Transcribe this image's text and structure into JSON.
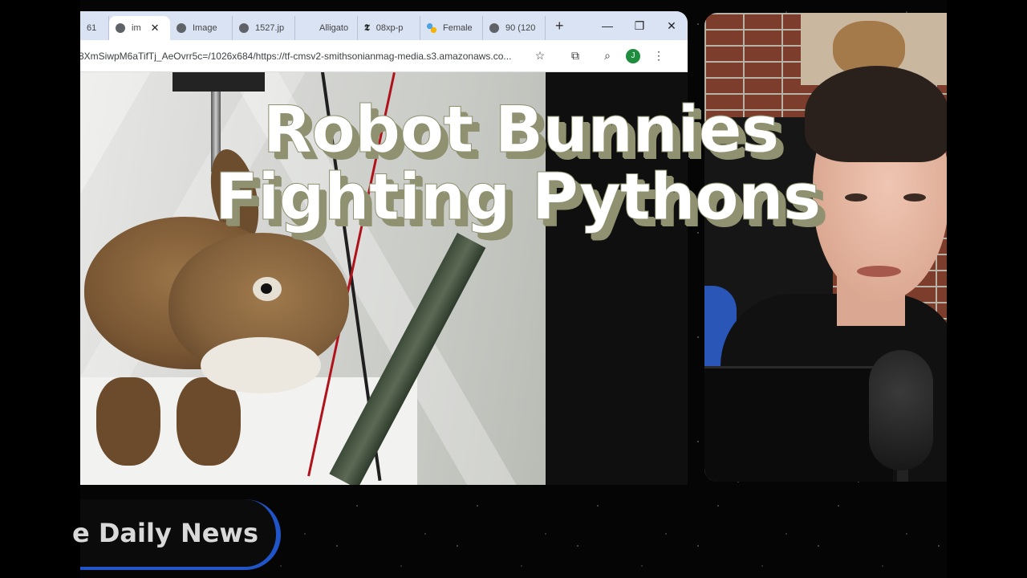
{
  "browser": {
    "tabs": [
      {
        "label": "61",
        "icon": "none",
        "active": false
      },
      {
        "label": "im",
        "icon": "globe-icon",
        "active": true
      },
      {
        "label": "Image",
        "icon": "globe-icon",
        "active": false
      },
      {
        "label": "1527.jp",
        "icon": "globe-icon",
        "active": false
      },
      {
        "label": "Alligato",
        "icon": "none",
        "active": false
      },
      {
        "label": "08xp-p",
        "icon": "nyt-icon",
        "active": false
      },
      {
        "label": "Female",
        "icon": "multi-dot-icon",
        "active": false
      },
      {
        "label": "90 (120",
        "icon": "globe-icon",
        "active": false
      }
    ],
    "new_tab_label": "+",
    "close_tab_label": "✕",
    "window_controls": {
      "minimize": "—",
      "restore": "❐",
      "close": "✕"
    },
    "url": "8XmSiwpM6aTifTj_AeOvrr5c=/1026x684/https://tf-cmsv2-smithsonianmag-media.s3.amazonaws.co...",
    "profile_initial": "J"
  },
  "headline": {
    "line1": "Robot Bunnies",
    "line2": "Fighting Pythons"
  },
  "lower_third": {
    "text": "e Daily News"
  },
  "colors": {
    "headline_shadow": "#8f9170",
    "lower_third_accent": "#1f55c8",
    "tabstrip_bg": "#d9e3f3"
  }
}
